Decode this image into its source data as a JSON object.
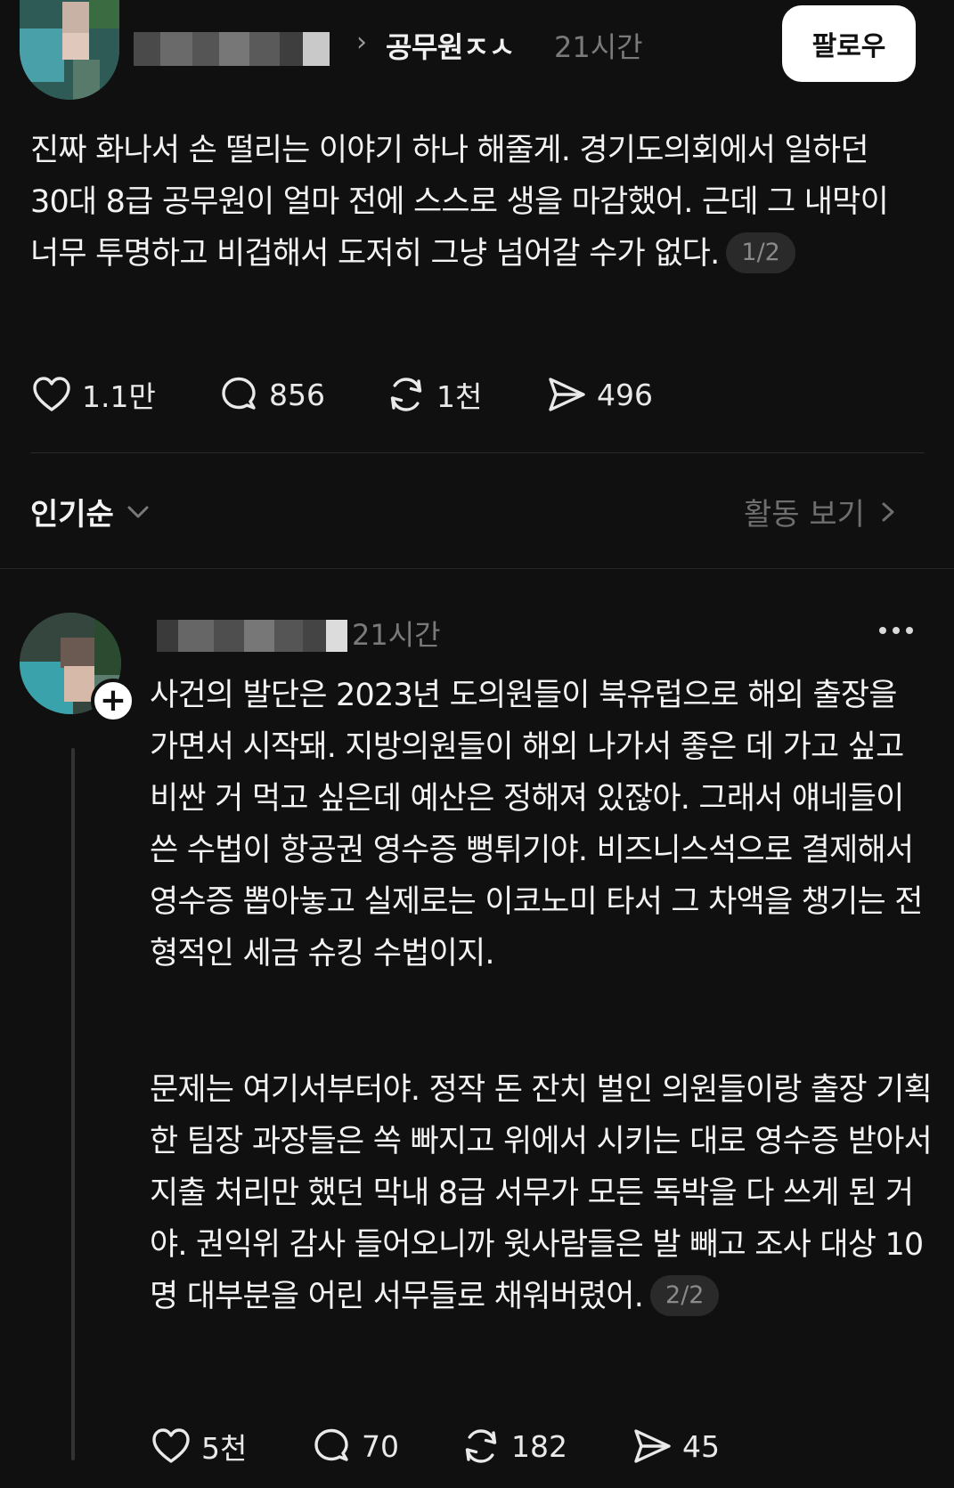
{
  "post": {
    "topic": "공무원ㅈㅅ",
    "time": "21시간",
    "follow_label": "팔로우",
    "text": "진짜 화나서 손 떨리는 이야기 하나 해줄게. 경기도의회에서 일하던 30대 8급 공무원이 얼마 전에 스스로 생을 마감했어. 근데 그 내막이 너무 투명하고 비겁해서 도저히 그냥 넘어갈 수가 없다.",
    "page": "1/2",
    "likes": "1.1만",
    "comments": "856",
    "reposts": "1천",
    "shares": "496"
  },
  "sort": {
    "label": "인기순",
    "activity_label": "활동 보기"
  },
  "reply": {
    "time": "21시간",
    "paragraph1": "사건의 발단은 2023년 도의원들이 북유럽으로 해외 출장을 가면서 시작돼. 지방의원들이 해외 나가서 좋은 데 가고 싶고 비싼 거 먹고 싶은데 예산은 정해져 있잖아. 그래서 얘네들이 쓴 수법이 항공권 영수증 뻥튀기야. 비즈니스석으로 결제해서 영수증 뽑아놓고 실제로는 이코노미 타서 그 차액을 챙기는 전형적인 세금 슈킹 수법이지.",
    "paragraph2": "문제는 여기서부터야. 정작 돈 잔치 벌인 의원들이랑 출장 기획한 팀장 과장들은 쏙 빠지고 위에서 시키는 대로 영수증 받아서 지출 처리만 했던 막내 8급 서무가 모든 독박을 다 쓰게 된 거야. 권익위 감사 들어오니까 윗사람들은 발 빼고 조사 대상 10명 대부분을 어린 서무들로 채워버렸어.",
    "page": "2/2",
    "likes": "5천",
    "comments": "70",
    "reposts": "182",
    "shares": "45"
  },
  "icons": {
    "like": "heart-icon",
    "comment": "comment-bubble-icon",
    "repost": "repost-icon",
    "share": "send-icon",
    "sort": "chevron-down-icon",
    "activity": "chevron-right-icon",
    "more": "more-dots-icon",
    "follow_plus": "plus-icon"
  },
  "colors": {
    "background": "#101010",
    "text": "#f3f3f3",
    "muted": "#7a7a7a",
    "chip_bg": "#2a2a2a",
    "divider": "#2a2a2a",
    "follow_bg": "#ffffff"
  }
}
